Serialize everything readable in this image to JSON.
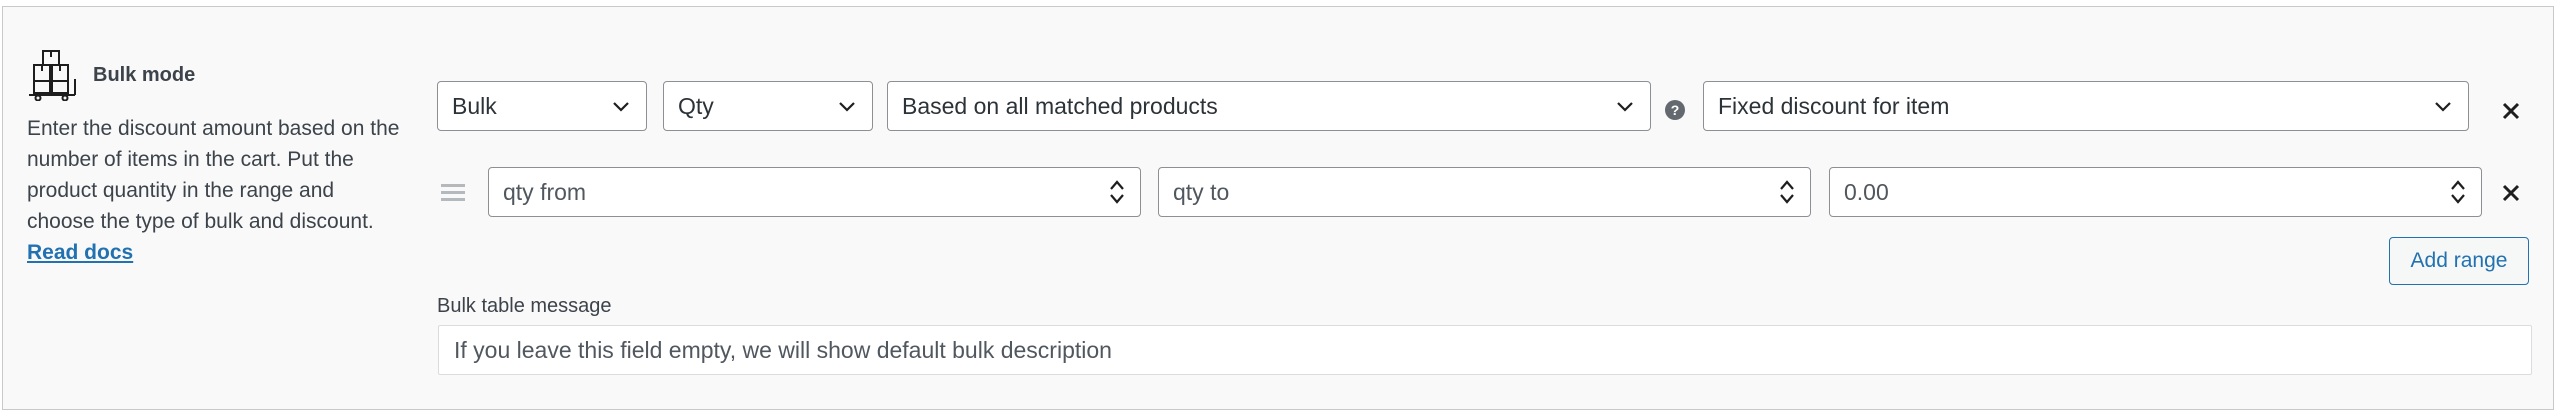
{
  "section": {
    "title": "Bulk mode",
    "description": "Enter the discount amount based on the number of items in the cart. Put the product quantity in the range and choose the type of bulk and discount.",
    "read_docs_label": "Read docs"
  },
  "row1": {
    "type_select": "Bulk",
    "measure_select": "Qty",
    "scope_select": "Based on all matched products",
    "help_icon": "question-mark-icon",
    "discount_type_select": "Fixed discount for item"
  },
  "range_row": {
    "qty_from_placeholder": "qty from",
    "qty_to_placeholder": "qty to",
    "value_placeholder": "0.00"
  },
  "add_range_label": "Add range",
  "bulk_table": {
    "label": "Bulk table message",
    "placeholder": "If you leave this field empty, we will show default bulk description"
  },
  "colors": {
    "accent": "#2271b1",
    "panel_bg": "#f9f9f9",
    "border": "#8c8f94"
  }
}
